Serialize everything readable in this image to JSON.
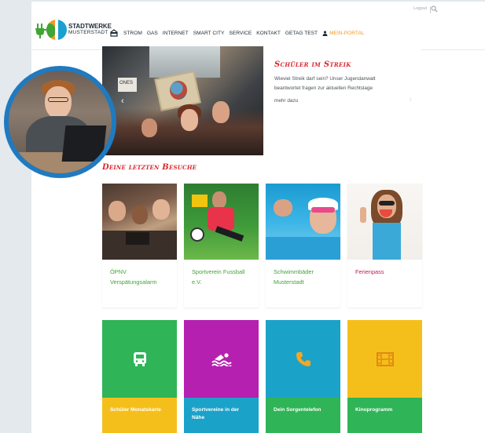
{
  "header": {
    "logout": "Logout",
    "logo": {
      "line1": "STADTWERKE",
      "line2": "MUSTERSTADT"
    },
    "nav": [
      "STROM",
      "GAS",
      "INTERNET",
      "SMART CITY",
      "SERVICE",
      "KONTAKT",
      "GETAG TEST"
    ],
    "portal": "MEIN-PORTAL"
  },
  "hero": {
    "image_sign": "ONES",
    "title": "Schüler im Streik",
    "description": "Wieviel Streik darf sein? Unser Jugendanwalt beantwortet fragen zur aktuellen Rechtslage",
    "more": "mehr dazu"
  },
  "recent": {
    "title": "Deine letzten Besuche",
    "cards": [
      {
        "label": "ÖPNV Verspätungsalarm"
      },
      {
        "label": "Sportverein Fussball e.V."
      },
      {
        "label": "Schwimmbäder Musterstadt"
      },
      {
        "label": "Ferienpass"
      }
    ]
  },
  "tiles": [
    {
      "label": "Schüler Monatskarte",
      "icon": "bus-icon",
      "top": "#2fb457",
      "bottom": "#f5bf1b"
    },
    {
      "label": "Sportvereine in der Nähe",
      "icon": "swimmer-icon",
      "top": "#b520b0",
      "bottom": "#1ba2c9"
    },
    {
      "label": "Dein Sorgentelefon",
      "icon": "phone-icon",
      "top": "#1ba2c9",
      "bottom": "#2fb457"
    },
    {
      "label": "Kinoprogramm",
      "icon": "film-icon",
      "top": "#f5bf1b",
      "bottom": "#2fb457"
    }
  ],
  "colors": {
    "accent_red": "#d8282f",
    "green": "#3fa535",
    "orange": "#f39a22",
    "avatar_ring": "#1f7ac0"
  }
}
